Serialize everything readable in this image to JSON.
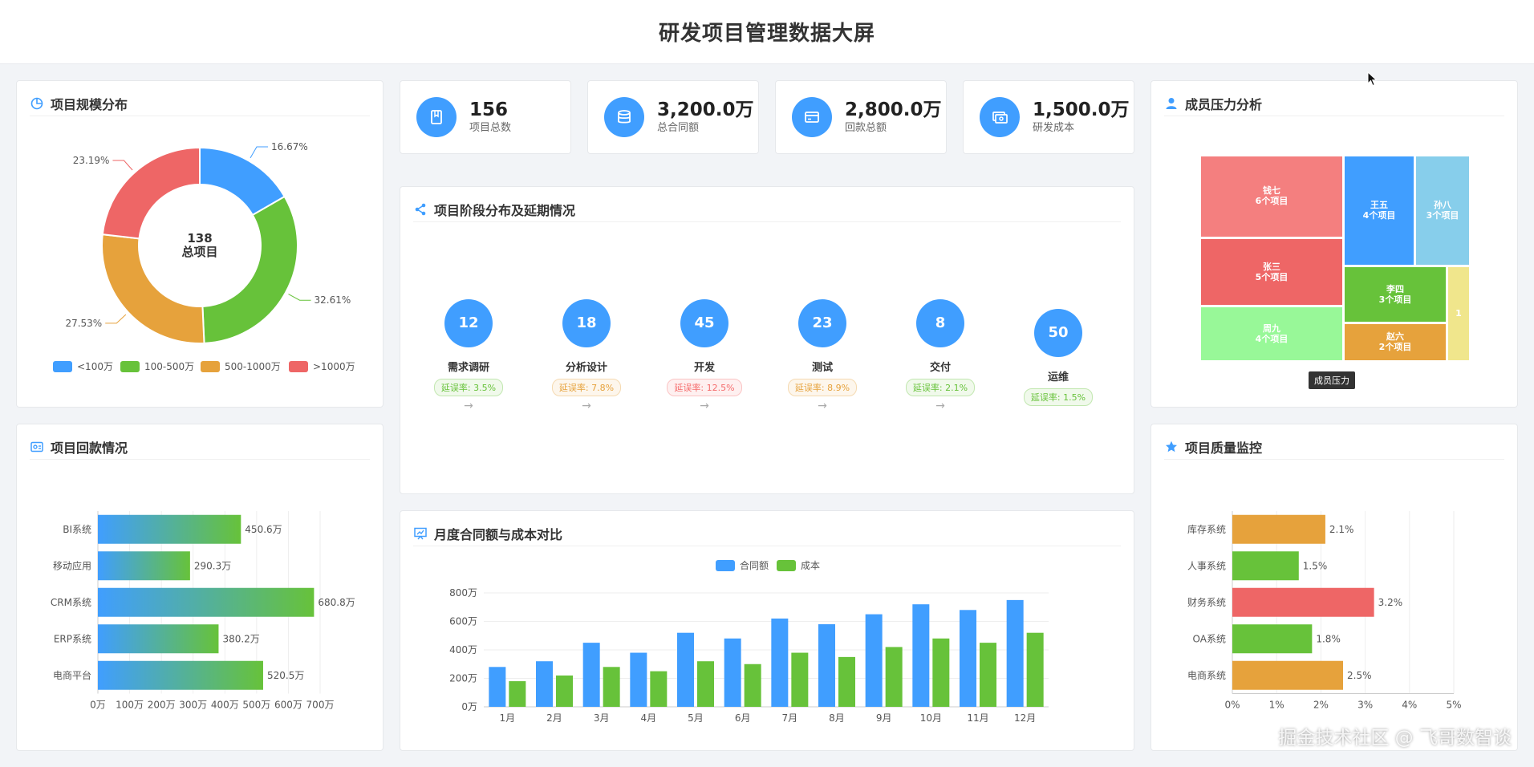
{
  "header": {
    "title": "研发项目管理数据大屏"
  },
  "stats": [
    {
      "value": "156",
      "label": "项目总数",
      "icon": "book-icon"
    },
    {
      "value": "3,200.0万",
      "label": "总合同额",
      "icon": "database-icon"
    },
    {
      "value": "2,800.0万",
      "label": "回款总额",
      "icon": "credit-card-icon"
    },
    {
      "value": "1,500.0万",
      "label": "研发成本",
      "icon": "money-icon"
    }
  ],
  "scale": {
    "title": "项目规模分布",
    "center_value": "138",
    "center_label": "总项目"
  },
  "stages": {
    "title": "项目阶段分布及延期情况",
    "items": [
      {
        "count": "12",
        "name": "需求调研",
        "rate": "延误率: 3.5%",
        "level": "low"
      },
      {
        "count": "18",
        "name": "分析设计",
        "rate": "延误率: 7.8%",
        "level": "mid"
      },
      {
        "count": "45",
        "name": "开发",
        "rate": "延误率: 12.5%",
        "level": "high"
      },
      {
        "count": "23",
        "name": "测试",
        "rate": "延误率: 8.9%",
        "level": "mid"
      },
      {
        "count": "8",
        "name": "交付",
        "rate": "延误率: 2.1%",
        "level": "low"
      },
      {
        "count": "50",
        "name": "运维",
        "rate": "延误率: 1.5%",
        "level": "low"
      }
    ],
    "arrow": "→"
  },
  "pressure": {
    "title": "成员压力分析",
    "tooltip": "成员压力",
    "members": [
      {
        "name": "钱七",
        "projects": "6个项目",
        "value": 6,
        "color": "#f47f7f"
      },
      {
        "name": "王五",
        "projects": "4个项目",
        "value": 4,
        "color": "#409eff"
      },
      {
        "name": "孙八",
        "projects": "3个项目",
        "value": 3,
        "color": "#87ceeb"
      },
      {
        "name": "张三",
        "projects": "5个项目",
        "value": 5,
        "color": "#ee6666"
      },
      {
        "name": "李四",
        "projects": "3个项目",
        "value": 3,
        "color": "#67c23a"
      },
      {
        "name": "周九",
        "projects": "4个项目",
        "value": 4,
        "color": "#98f898"
      },
      {
        "name": "赵六",
        "projects": "2个项目",
        "value": 2,
        "color": "#e6a23c"
      },
      {
        "name": "",
        "projects": "1",
        "value": 1,
        "color": "#f0e68c"
      }
    ]
  },
  "payment": {
    "title": "项目回款情况"
  },
  "monthly": {
    "title": "月度合同额与成本对比"
  },
  "quality": {
    "title": "项目质量监控"
  },
  "watermark": "掘金技术社区 @ 飞哥数智谈",
  "colors": {
    "accent": "#409eff",
    "green": "#67c23a",
    "orange": "#e6a23c",
    "red": "#ee6666"
  },
  "chart_data": [
    {
      "type": "pie",
      "categories": [
        "<100万",
        "100-500万",
        "500-1000万",
        ">1000万"
      ],
      "values": [
        16.67,
        32.61,
        27.53,
        23.19
      ],
      "labels": [
        "16.67%",
        "32.61%",
        "27.53%",
        "23.19%"
      ],
      "colors": [
        "#409eff",
        "#67c23a",
        "#e6a23c",
        "#ee6666"
      ],
      "legend": "bottom"
    },
    {
      "type": "bar",
      "orientation": "horizontal",
      "categories": [
        "BI系统",
        "移动应用",
        "CRM系统",
        "ERP系统",
        "电商平台"
      ],
      "values": [
        450.6,
        290.3,
        680.8,
        380.2,
        520.5
      ],
      "labels": [
        "450.6万",
        "290.3万",
        "680.8万",
        "380.2万",
        "520.5万"
      ],
      "xticks": [
        "0万",
        "100万",
        "200万",
        "300万",
        "400万",
        "500万",
        "600万",
        "700万"
      ],
      "xlim": [
        0,
        700
      ]
    },
    {
      "type": "bar",
      "categories": [
        "1月",
        "2月",
        "3月",
        "4月",
        "5月",
        "6月",
        "7月",
        "8月",
        "9月",
        "10月",
        "11月",
        "12月"
      ],
      "series": [
        {
          "name": "合同额",
          "values": [
            280,
            320,
            450,
            380,
            520,
            480,
            620,
            580,
            650,
            720,
            680,
            750
          ],
          "color": "#409eff"
        },
        {
          "name": "成本",
          "values": [
            180,
            220,
            280,
            250,
            320,
            300,
            380,
            350,
            420,
            480,
            450,
            520
          ],
          "color": "#67c23a"
        }
      ],
      "yticks": [
        "0万",
        "200万",
        "400万",
        "600万",
        "800万"
      ],
      "ylim": [
        0,
        800
      ],
      "legend": "top"
    },
    {
      "type": "bar",
      "orientation": "horizontal",
      "categories": [
        "库存系统",
        "人事系统",
        "财务系统",
        "OA系统",
        "电商系统"
      ],
      "values": [
        2.1,
        1.5,
        3.2,
        1.8,
        2.5
      ],
      "labels": [
        "2.1%",
        "1.5%",
        "3.2%",
        "1.8%",
        "2.5%"
      ],
      "colors": [
        "#e6a23c",
        "#67c23a",
        "#ee6666",
        "#67c23a",
        "#e6a23c"
      ],
      "xticks": [
        "0%",
        "1%",
        "2%",
        "3%",
        "4%",
        "5%"
      ],
      "xlim": [
        0,
        5
      ]
    }
  ]
}
